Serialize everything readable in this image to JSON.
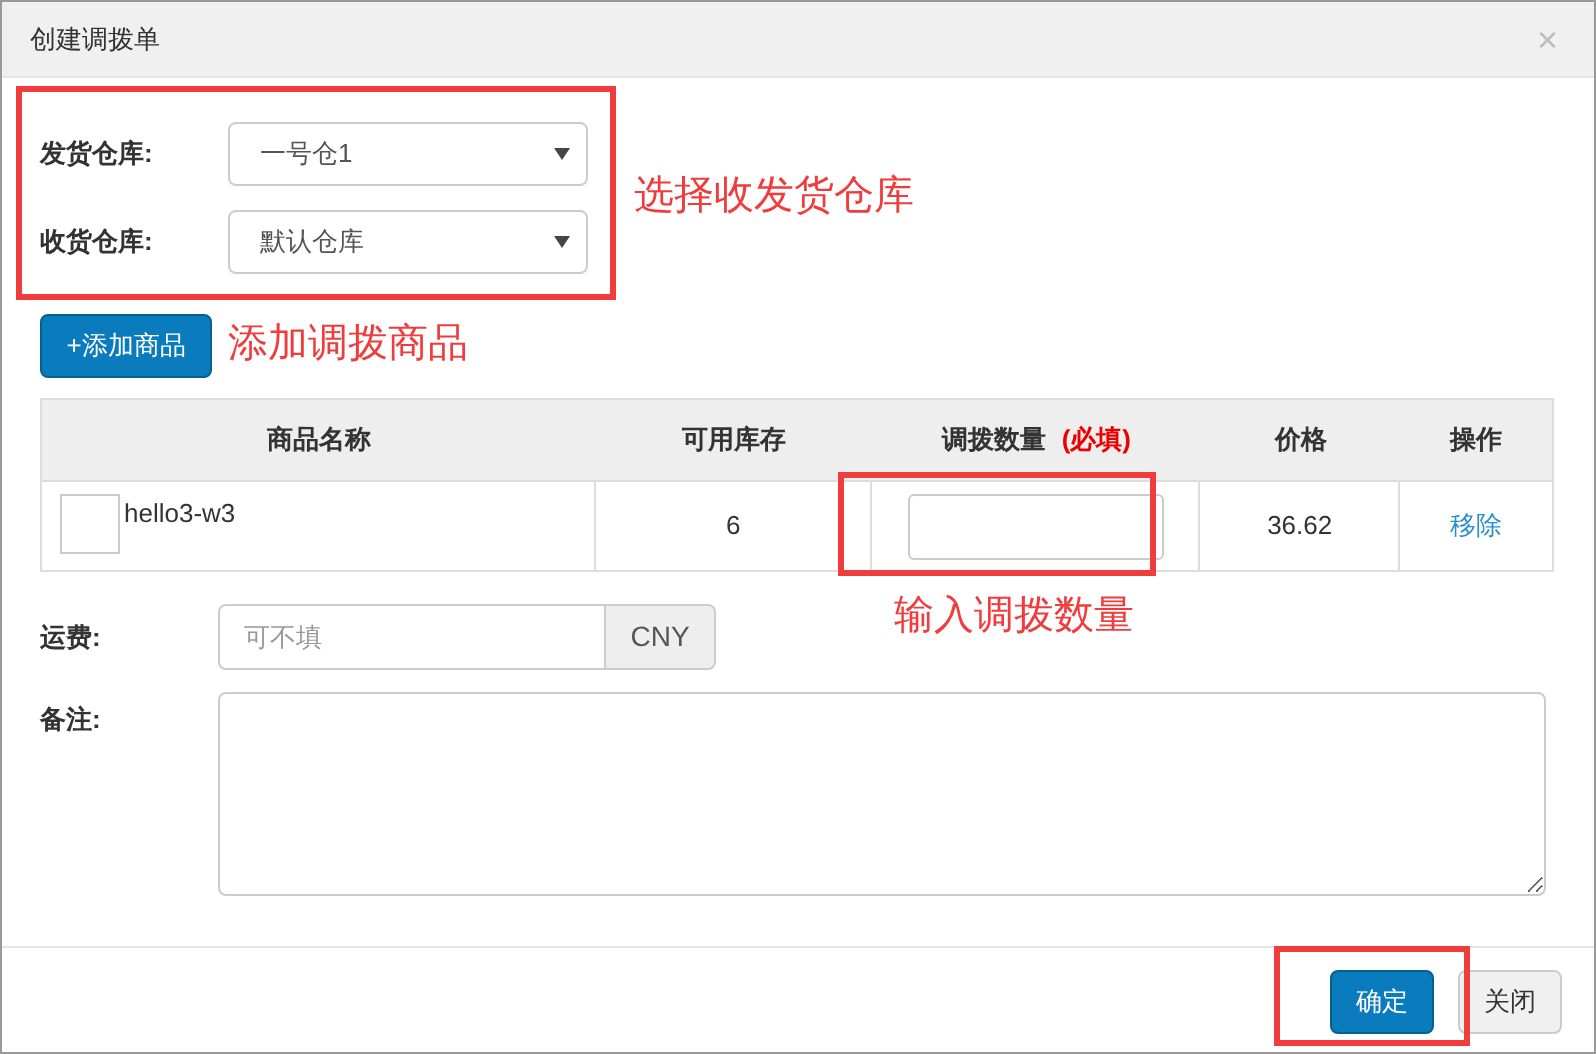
{
  "dialog": {
    "title": "创建调拨单",
    "close": "×"
  },
  "warehouses": [
    {
      "label": "发货仓库:",
      "value": "一号仓1"
    },
    {
      "label": "收货仓库:",
      "value": "默认仓库"
    }
  ],
  "add_button": "+添加商品",
  "table": {
    "columns": [
      {
        "label": "商品名称"
      },
      {
        "label": "可用库存"
      },
      {
        "label": "调拨数量",
        "required": "(必填)"
      },
      {
        "label": "价格"
      },
      {
        "label": "操作"
      }
    ],
    "rows": [
      {
        "name": "hello3-w3",
        "stock": "6",
        "price": "36.62",
        "action": "移除"
      }
    ]
  },
  "freight": {
    "label": "运费:",
    "placeholder": "可不填",
    "unit": "CNY"
  },
  "notes": {
    "label": "备注:"
  },
  "buttons": [
    {
      "label": "确定",
      "kind": "primary"
    },
    {
      "label": "关闭",
      "kind": "default"
    }
  ],
  "annotations": [
    {
      "kind": "box"
    },
    {
      "kind": "text",
      "text": "选择收发货仓库"
    },
    {
      "kind": "text",
      "text": "添加调拨商品"
    },
    {
      "kind": "box"
    },
    {
      "kind": "text",
      "text": "输入调拨数量"
    },
    {
      "kind": "box"
    }
  ]
}
